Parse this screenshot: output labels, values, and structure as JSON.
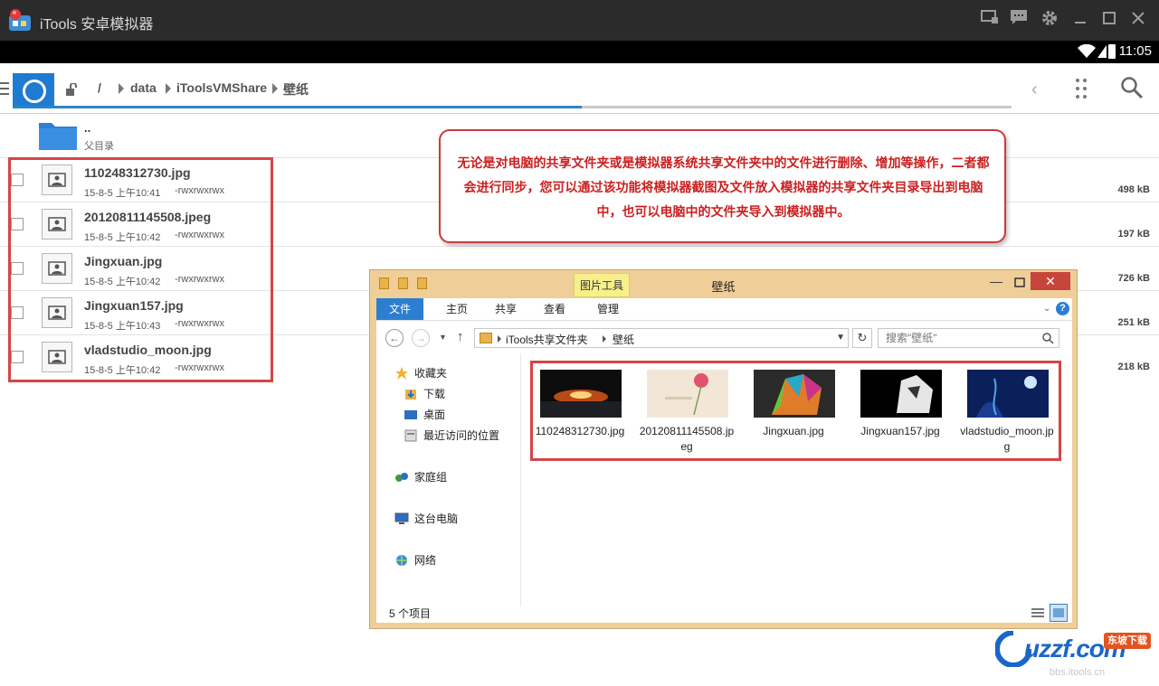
{
  "window": {
    "title": "iTools 安卓模拟器"
  },
  "status_bar": {
    "time": "11:05"
  },
  "breadcrumb": {
    "root": "/",
    "segments": [
      "data",
      "iToolsVMShare",
      "壁纸"
    ]
  },
  "progress": {
    "fraction": 0.57
  },
  "parent_entry": {
    "name": "..",
    "subtitle": "父目录"
  },
  "files": [
    {
      "name": "110248312730.jpg",
      "date": "15-8-5 上午10:41",
      "perm": "-rwxrwxrwx",
      "size": "498 kB"
    },
    {
      "name": "20120811145508.jpeg",
      "date": "15-8-5 上午10:42",
      "perm": "-rwxrwxrwx",
      "size": "197 kB"
    },
    {
      "name": "Jingxuan.jpg",
      "date": "15-8-5 上午10:42",
      "perm": "-rwxrwxrwx",
      "size": "726 kB"
    },
    {
      "name": "Jingxuan157.jpg",
      "date": "15-8-5 上午10:43",
      "perm": "-rwxrwxrwx",
      "size": "251 kB"
    },
    {
      "name": "vladstudio_moon.jpg",
      "date": "15-8-5 上午10:42",
      "perm": "-rwxrwxrwx",
      "size": "218 kB"
    }
  ],
  "callout": {
    "text": "无论是对电脑的共享文件夹或是模拟器系统共享文件夹中的文件进行删除、增加等操作，二者都会进行同步，您可以通过该功能将模拟器截图及文件放入模拟器的共享文件夹目录导出到电脑中，也可以电脑中的文件夹导入到模拟器中。"
  },
  "explorer": {
    "title": "壁纸",
    "tools_tab": "图片工具",
    "tabs": [
      "文件",
      "主页",
      "共享",
      "查看",
      "管理"
    ],
    "address_segments": [
      "iTools共享文件夹",
      "壁纸"
    ],
    "search_placeholder": "搜索\"壁纸\"",
    "nav_items": [
      "收藏夹",
      "下载",
      "桌面",
      "最近访问的位置",
      "家庭组",
      "这台电脑",
      "网络"
    ],
    "thumbnails": [
      {
        "label": "110248312730.jpg"
      },
      {
        "label": "20120811145508.jpeg"
      },
      {
        "label": "Jingxuan.jpg"
      },
      {
        "label": "Jingxuan157.jpg"
      },
      {
        "label": "vladstudio_moon.jpg"
      }
    ],
    "status_count": "5 个项目"
  },
  "watermark": {
    "logo": "uzzf.com",
    "tag": "东坡下载",
    "sub": "bbs.itools.cn"
  },
  "icons": {
    "window_controls": [
      "screen-icon",
      "chat-icon",
      "gear-icon",
      "minimize-icon",
      "maximize-icon",
      "close-icon"
    ]
  },
  "colors": {
    "accent": "#1f7bd1",
    "highlight_frame": "#d64545",
    "callout_text": "#cc1f1f"
  }
}
